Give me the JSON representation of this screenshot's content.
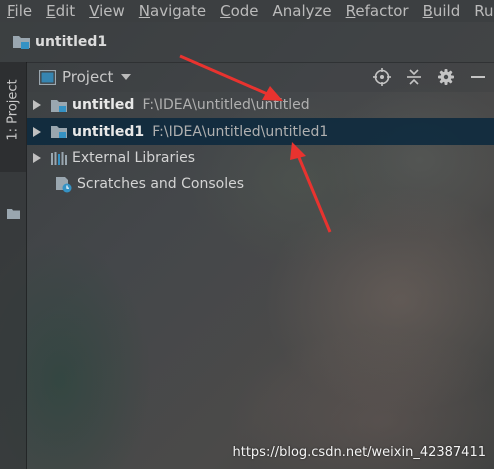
{
  "menu": {
    "items": [
      {
        "mnemonic": "F",
        "rest": "ile"
      },
      {
        "mnemonic": "E",
        "rest": "dit"
      },
      {
        "mnemonic": "V",
        "rest": "iew"
      },
      {
        "mnemonic": "N",
        "rest": "avigate"
      },
      {
        "mnemonic": "C",
        "rest": "ode"
      },
      {
        "mnemonic": "",
        "rest": "Analyze"
      },
      {
        "mnemonic": "R",
        "rest": "efactor"
      },
      {
        "mnemonic": "B",
        "rest": "uild"
      },
      {
        "mnemonic": "",
        "rest": "Ru"
      }
    ]
  },
  "navbar": {
    "title": "untitled1",
    "icon": "project-folder-icon"
  },
  "toolstrip": {
    "project_tab_label": "1: Project"
  },
  "panel": {
    "title": "Project",
    "tools": [
      "locate-target-icon",
      "collapse-all-icon",
      "settings-gear-icon",
      "hide-minimize-icon"
    ]
  },
  "tree": {
    "rows": [
      {
        "name": "untitled",
        "path": "F:\\IDEA\\untitled\\untitled",
        "selected": false
      },
      {
        "name": "untitled1",
        "path": "F:\\IDEA\\untitled\\untitled1",
        "selected": true
      },
      {
        "label": "External Libraries"
      },
      {
        "label": "Scratches and Consoles"
      }
    ]
  },
  "watermark": "https://blog.csdn.net/weixin_42387411",
  "colors": {
    "menubar_bg": "#3c3f41",
    "selection_bg": "#0d293e",
    "annotation_red": "#e8332f",
    "module_blue": "#3592c4"
  }
}
